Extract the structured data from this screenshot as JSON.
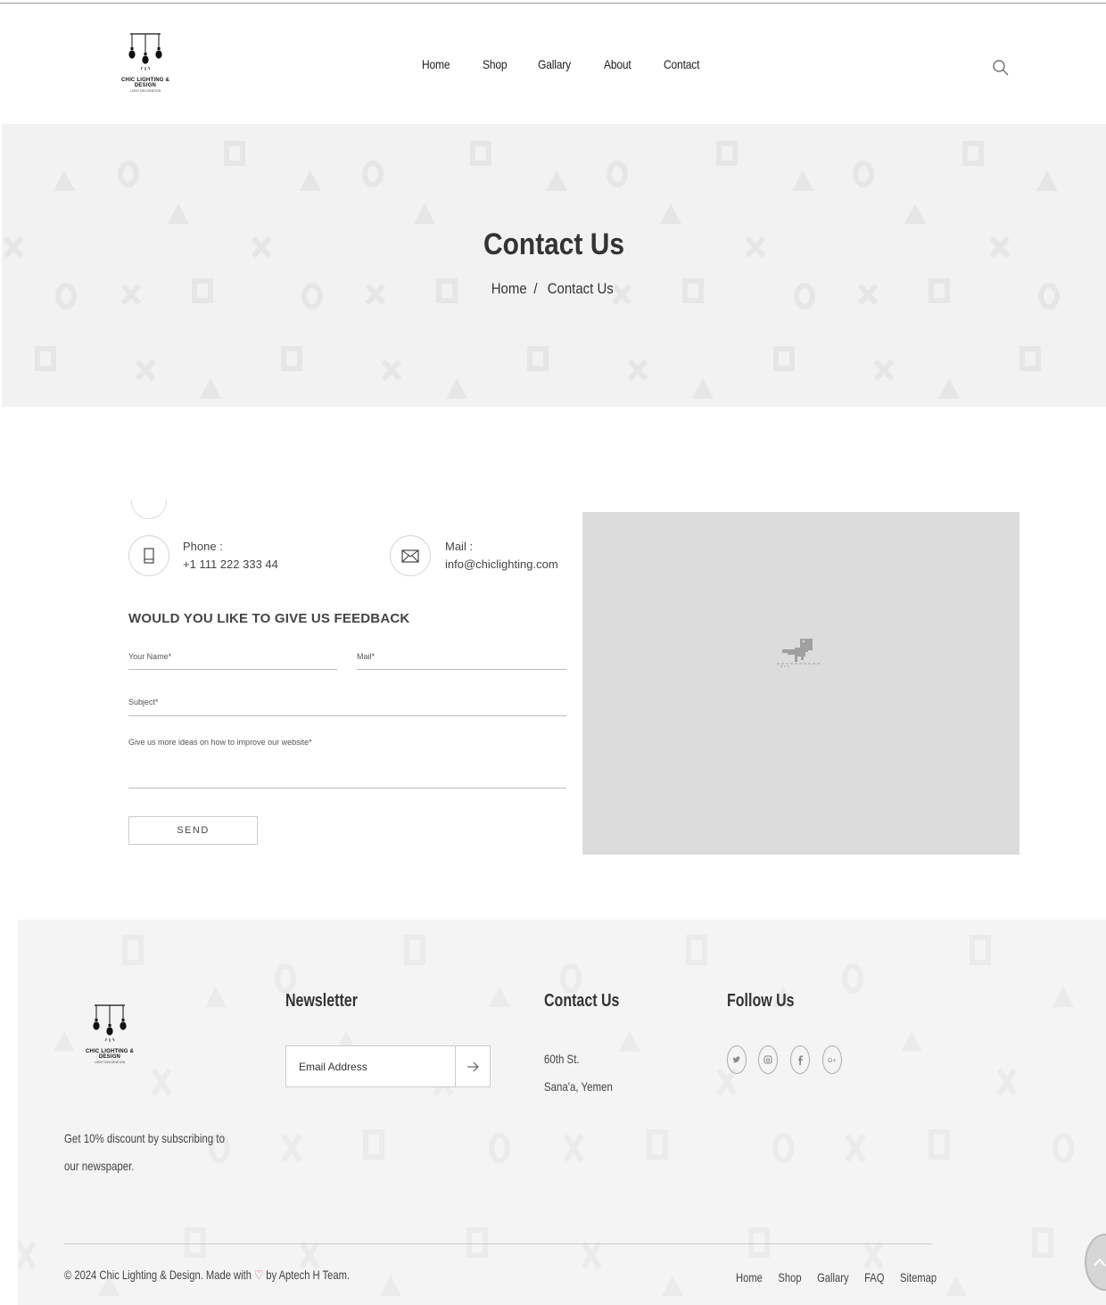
{
  "header": {
    "logo_text": "CHIC LIGHTING & DESIGN",
    "logo_sub": "LIGHT DECORATION",
    "nav": [
      "Home",
      "Shop",
      "Gallary",
      "About",
      "Contact"
    ],
    "search_icon": "search-icon"
  },
  "banner": {
    "title": "Contact Us",
    "breadcrumb": {
      "home": "Home",
      "separator": "/",
      "current": "Contact Us"
    }
  },
  "contact": {
    "phone_label": "Phone :",
    "phone_value": "+1 111 222 333 44",
    "mail_label": "Mail :",
    "mail_value": "info@chiclighting.com",
    "feedback_title": "WOULD YOU LIKE TO GIVE US FEEDBACK",
    "name_placeholder": "Your Name*",
    "mail_placeholder": "Mail*",
    "subject_placeholder": "Subject*",
    "message_placeholder": "Give us more ideas on how to improve our website*",
    "send_label": "SEND"
  },
  "footer": {
    "logo_text": "CHIC LIGHTING & DESIGN",
    "logo_sub": "LIGHT DECORATION",
    "description": "Get 10% discount by subscribing to our newspaper.",
    "newsletter_title": "Newsletter",
    "newsletter_placeholder": "Email Address",
    "contact_title": "Contact Us",
    "address_line1": "60th St.",
    "address_line2": "Sana'a, Yemen",
    "follow_title": "Follow Us",
    "social": [
      "twitter-icon",
      "instagram-icon",
      "facebook-icon",
      "google-plus-icon"
    ],
    "copyright_prefix": "© 2024 Chic Lighting & Design. Made with",
    "copyright_suffix": "by Aptech H Team.",
    "bottom_nav": [
      "Home",
      "Shop",
      "Gallary",
      "FAQ",
      "Sitemap"
    ],
    "accent_heart": "#e2454f"
  }
}
